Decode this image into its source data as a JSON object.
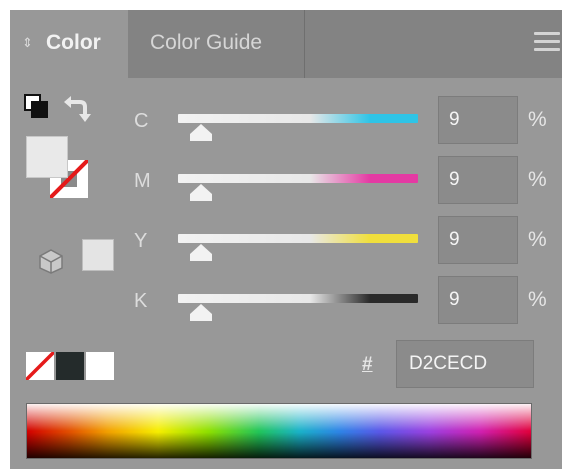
{
  "tabs": [
    {
      "label": "Color",
      "active": true
    },
    {
      "label": "Color Guide",
      "active": false
    }
  ],
  "icons": {
    "tab_arrows": "⇕",
    "menu": "hamburger-menu-icon",
    "hash": "#"
  },
  "channels": [
    {
      "label": "C",
      "value": "9",
      "unit": "%",
      "gradient_end": "#2fc4e6"
    },
    {
      "label": "M",
      "value": "9",
      "unit": "%",
      "gradient_end": "#e43aa3"
    },
    {
      "label": "Y",
      "value": "9",
      "unit": "%",
      "gradient_end": "#f0df3c"
    },
    {
      "label": "K",
      "value": "9",
      "unit": "%",
      "gradient_end": "#2a2a2a"
    }
  ],
  "hex_value": "D2CECD",
  "colors": {
    "panel_bg": "#989898",
    "tabbar_bg": "#838383",
    "field_bg": "#8b8b8b",
    "black_swatch": "#242b2b",
    "none_slash": "#e51a1a"
  }
}
